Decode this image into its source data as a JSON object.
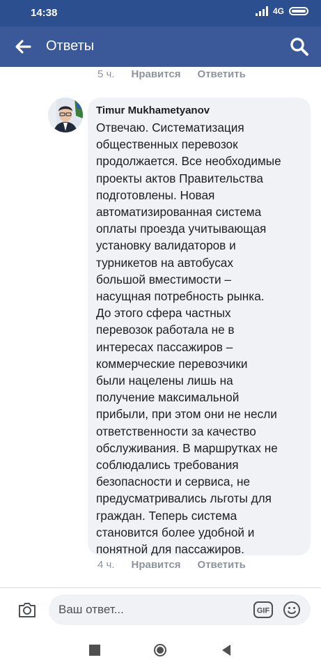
{
  "status_bar": {
    "time": "14:38",
    "network": "4G"
  },
  "app_bar": {
    "title": "Ответы"
  },
  "previous_comment": {
    "time": "5 ч.",
    "like": "Нравится",
    "reply": "Ответить"
  },
  "comment": {
    "author": "Timur Mukhametyanov",
    "text": "Отвечаю. Систематизация\nобщественных перевозок\nпродолжается. Все необходимые\nпроекты актов Правительства\nподготовлены. Новая\nавтоматизированная система\nоплаты проезда учитывающая\nустановку валидаторов  и\nтурникетов на автобусах\nбольшой вместимости –\nнасущная потребность рынка.\nДо этого сфера частных\nперевозок работала не в\nинтересах пассажиров –\nкоммерческие перевозчики\nбыли нацелены лишь на\nполучение максимальной\nприбыли, при этом они не несли\nответственности за качество\nобслуживания. В маршрутках не\nсоблюдались требования\nбезопасности и сервиса, не\nпредусматривались льготы для\nграждан. Теперь система\nстановится более удобной и\nпонятной для пассажиров.",
    "time": "4 ч.",
    "like": "Нравится",
    "reply": "Ответить"
  },
  "reply_bar": {
    "placeholder": "Ваш ответ...",
    "gif_label": "GIF"
  },
  "colors": {
    "header": "#3b5998",
    "status_bar": "#2c4f8f",
    "bubble": "#f0f2f5",
    "meta_text": "#8d949e"
  },
  "icons": [
    "back-arrow-icon",
    "search-icon",
    "camera-icon",
    "gif-icon",
    "smiley-icon",
    "square-nav-icon",
    "home-nav-icon",
    "back-nav-icon"
  ]
}
